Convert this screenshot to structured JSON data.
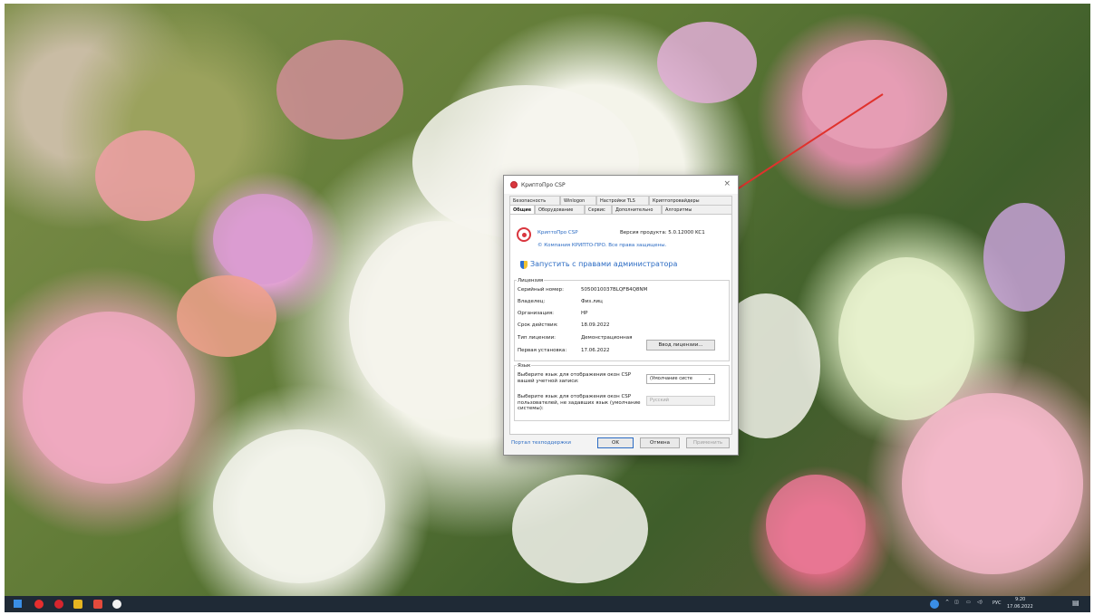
{
  "dialog": {
    "title": "КриптоПро CSP",
    "close": "×",
    "tabs_row1": [
      "Безопасность",
      "Winlogon",
      "Настройки TLS",
      "Криптопровайдеры"
    ],
    "tabs_row2": [
      "Общие",
      "Оборудование",
      "Сервис",
      "Дополнительно",
      "Алгоритмы"
    ],
    "active_tab": "Общие",
    "product_name": "КриптоПро CSP",
    "product_version": "Версия продукта: 5.0.12000 KC1",
    "copyright": "© Компания КРИПТО-ПРО. Все права защищены.",
    "run_as_admin": "Запустить с правами администратора",
    "license": {
      "group_title": "Лицензия",
      "fields": [
        {
          "label": "Серийный номер:",
          "value": "5050010037BLQFB4Q8NM"
        },
        {
          "label": "Владелец:",
          "value": "Физ.лиц"
        },
        {
          "label": "Организация:",
          "value": "HP"
        },
        {
          "label": "Срок действия:",
          "value": "18.09.2022"
        },
        {
          "label": "Тип лицензии:",
          "value": "Демонстрационная"
        },
        {
          "label": "Первая установка:",
          "value": "17.06.2022"
        }
      ],
      "enter_license_button": "Ввод лицензии..."
    },
    "language": {
      "group_title": "Язык",
      "account_label": "Выберите язык для отображения окон CSP вашей учетной записи:",
      "account_value": "(Умолчание систе",
      "users_label": "Выберите язык для отображения окон CSP пользователей, не задавших язык (умолчание системы):",
      "users_value": "Русский"
    },
    "support_link": "Портал техподдержки",
    "ok": "OK",
    "cancel": "Отмена",
    "apply": "Применить"
  },
  "taskbar": {
    "lang": "РУС",
    "time": "9:20",
    "date": "17.06.2022"
  },
  "colors": {
    "accent": "#2b6bc3",
    "brand_red": "#d9363e",
    "arrow": "#e0322d",
    "taskbar": "#1f2a36"
  }
}
